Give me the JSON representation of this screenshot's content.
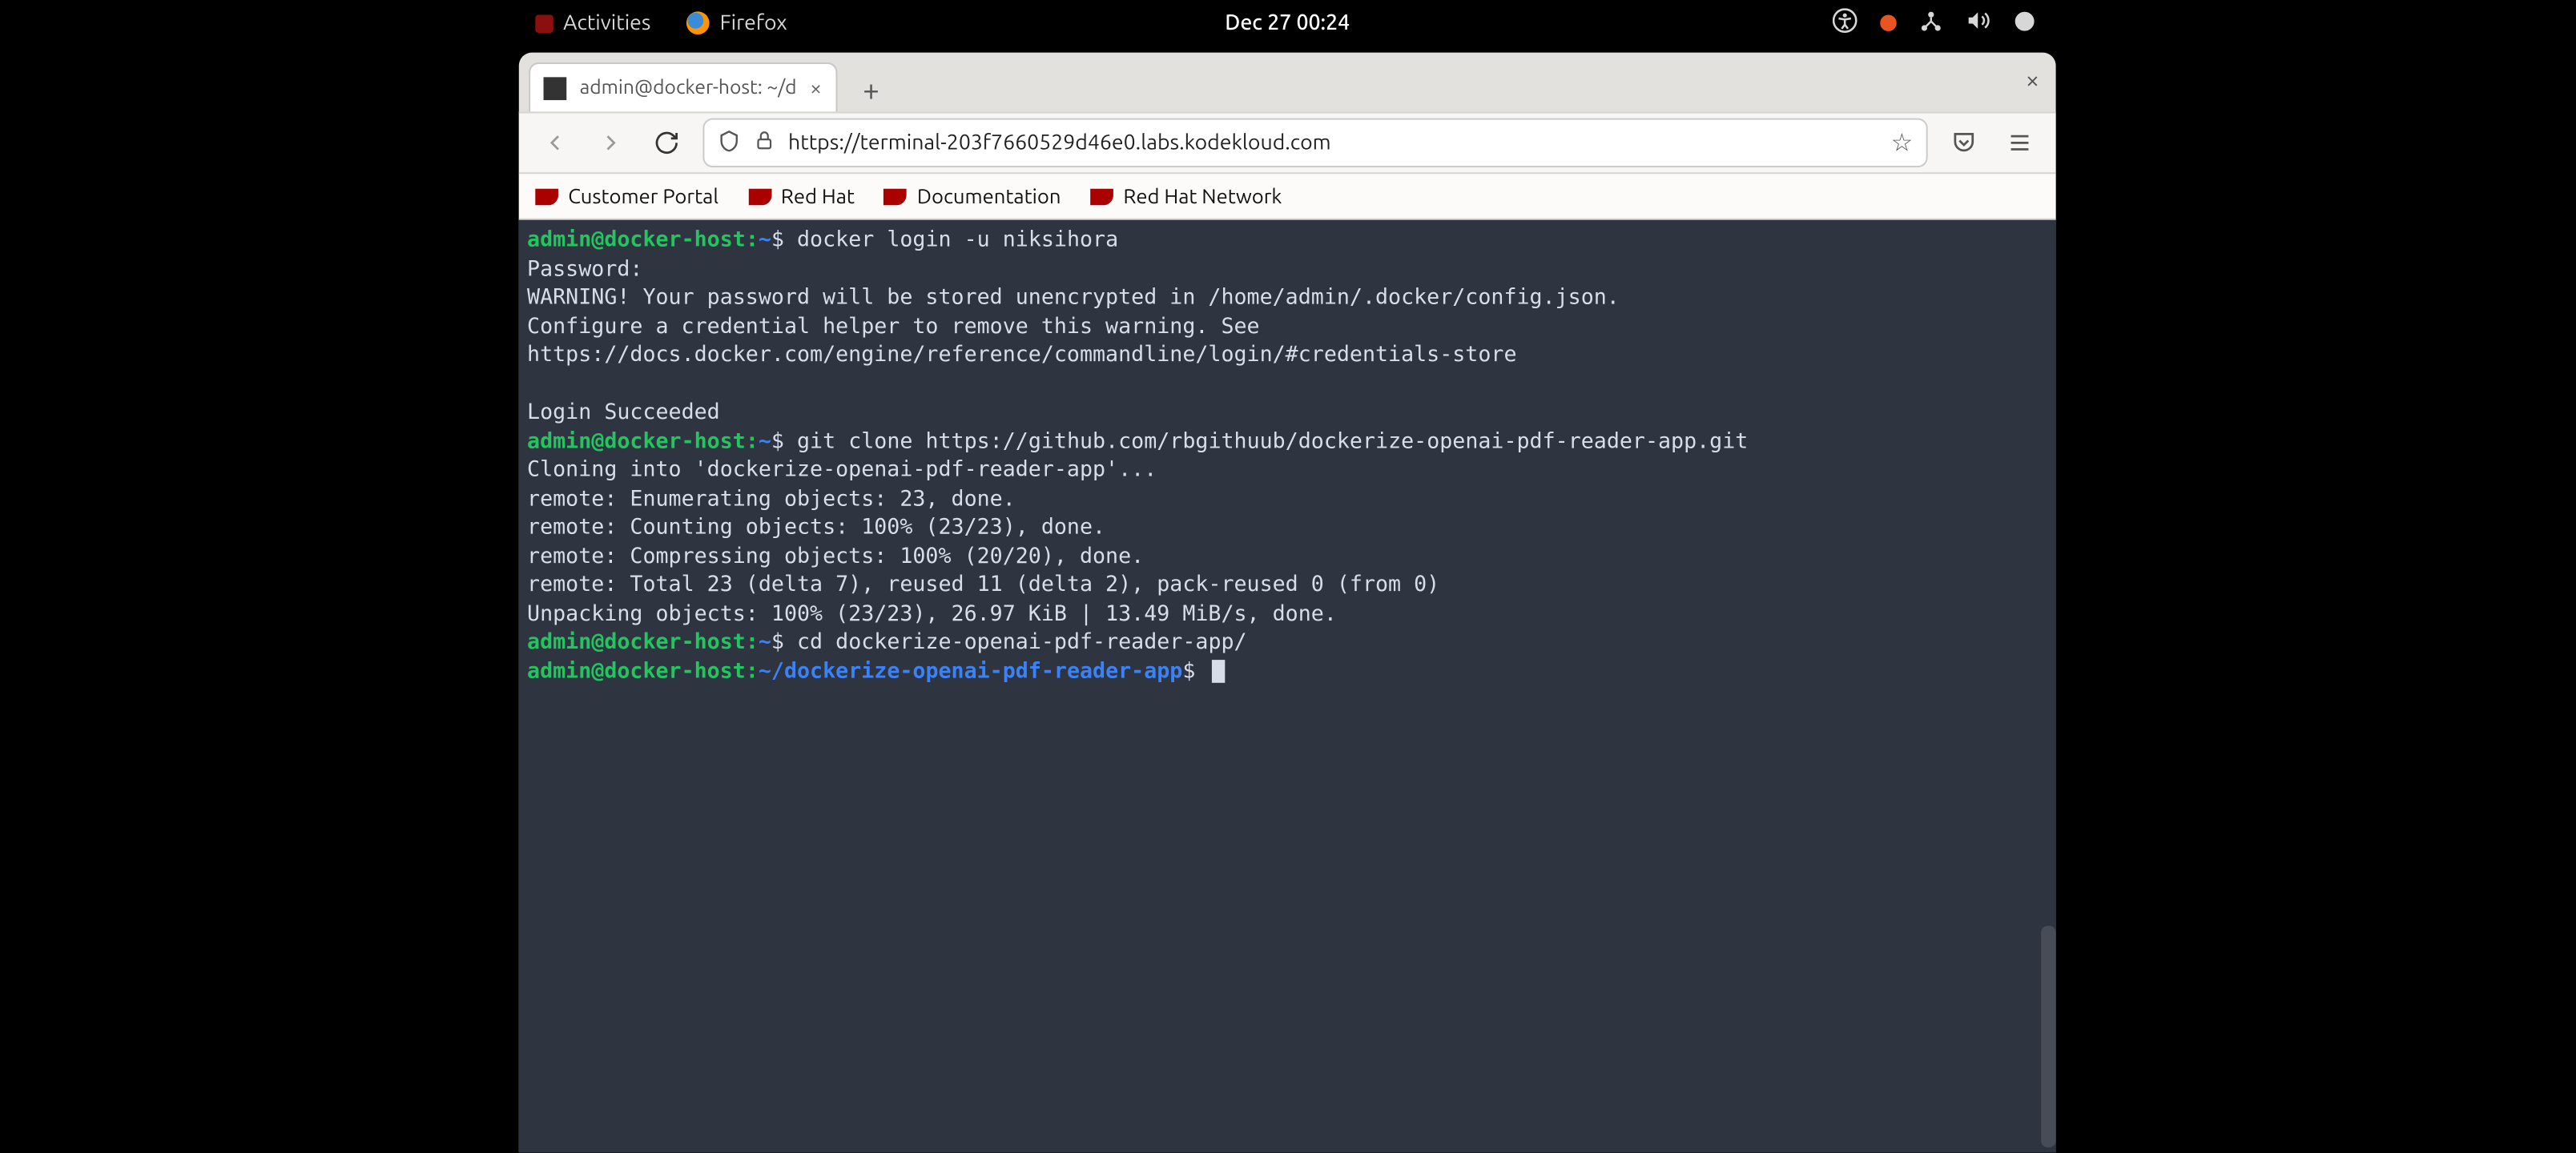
{
  "topbar": {
    "activities": "Activities",
    "app_name": "Firefox",
    "clock": "Dec 27  00:24"
  },
  "browser": {
    "tab_title": "admin@docker-host: ~/d",
    "url": "https://terminal-203f7660529d46e0.labs.kodekloud.com",
    "bookmarks": {
      "customer_portal": "Customer Portal",
      "red_hat": "Red Hat",
      "documentation": "Documentation",
      "red_hat_network": "Red Hat Network"
    }
  },
  "terminal": {
    "user": "admin@docker-host",
    "sep": ":",
    "home_path": "~",
    "repo_path": "~/dockerize-openai-pdf-reader-app",
    "dollar": "$",
    "cmd1": " docker login -u niksihora",
    "password_label": "Password:",
    "warn1": "WARNING! Your password will be stored unencrypted in /home/admin/.docker/config.json.",
    "warn2": "Configure a credential helper to remove this warning. See",
    "warn3": "https://docs.docker.com/engine/reference/commandline/login/#credentials-store",
    "login_ok": "Login Succeeded",
    "cmd2": " git clone https://github.com/rbgithuub/dockerize-openai-pdf-reader-app.git",
    "clone1": "Cloning into 'dockerize-openai-pdf-reader-app'...",
    "clone2": "remote: Enumerating objects: 23, done.",
    "clone3": "remote: Counting objects: 100% (23/23), done.",
    "clone4": "remote: Compressing objects: 100% (20/20), done.",
    "clone5": "remote: Total 23 (delta 7), reused 11 (delta 2), pack-reused 0 (from 0)",
    "clone6": "Unpacking objects: 100% (23/23), 26.97 KiB | 13.49 MiB/s, done.",
    "cmd3": " cd dockerize-openai-pdf-reader-app/"
  }
}
